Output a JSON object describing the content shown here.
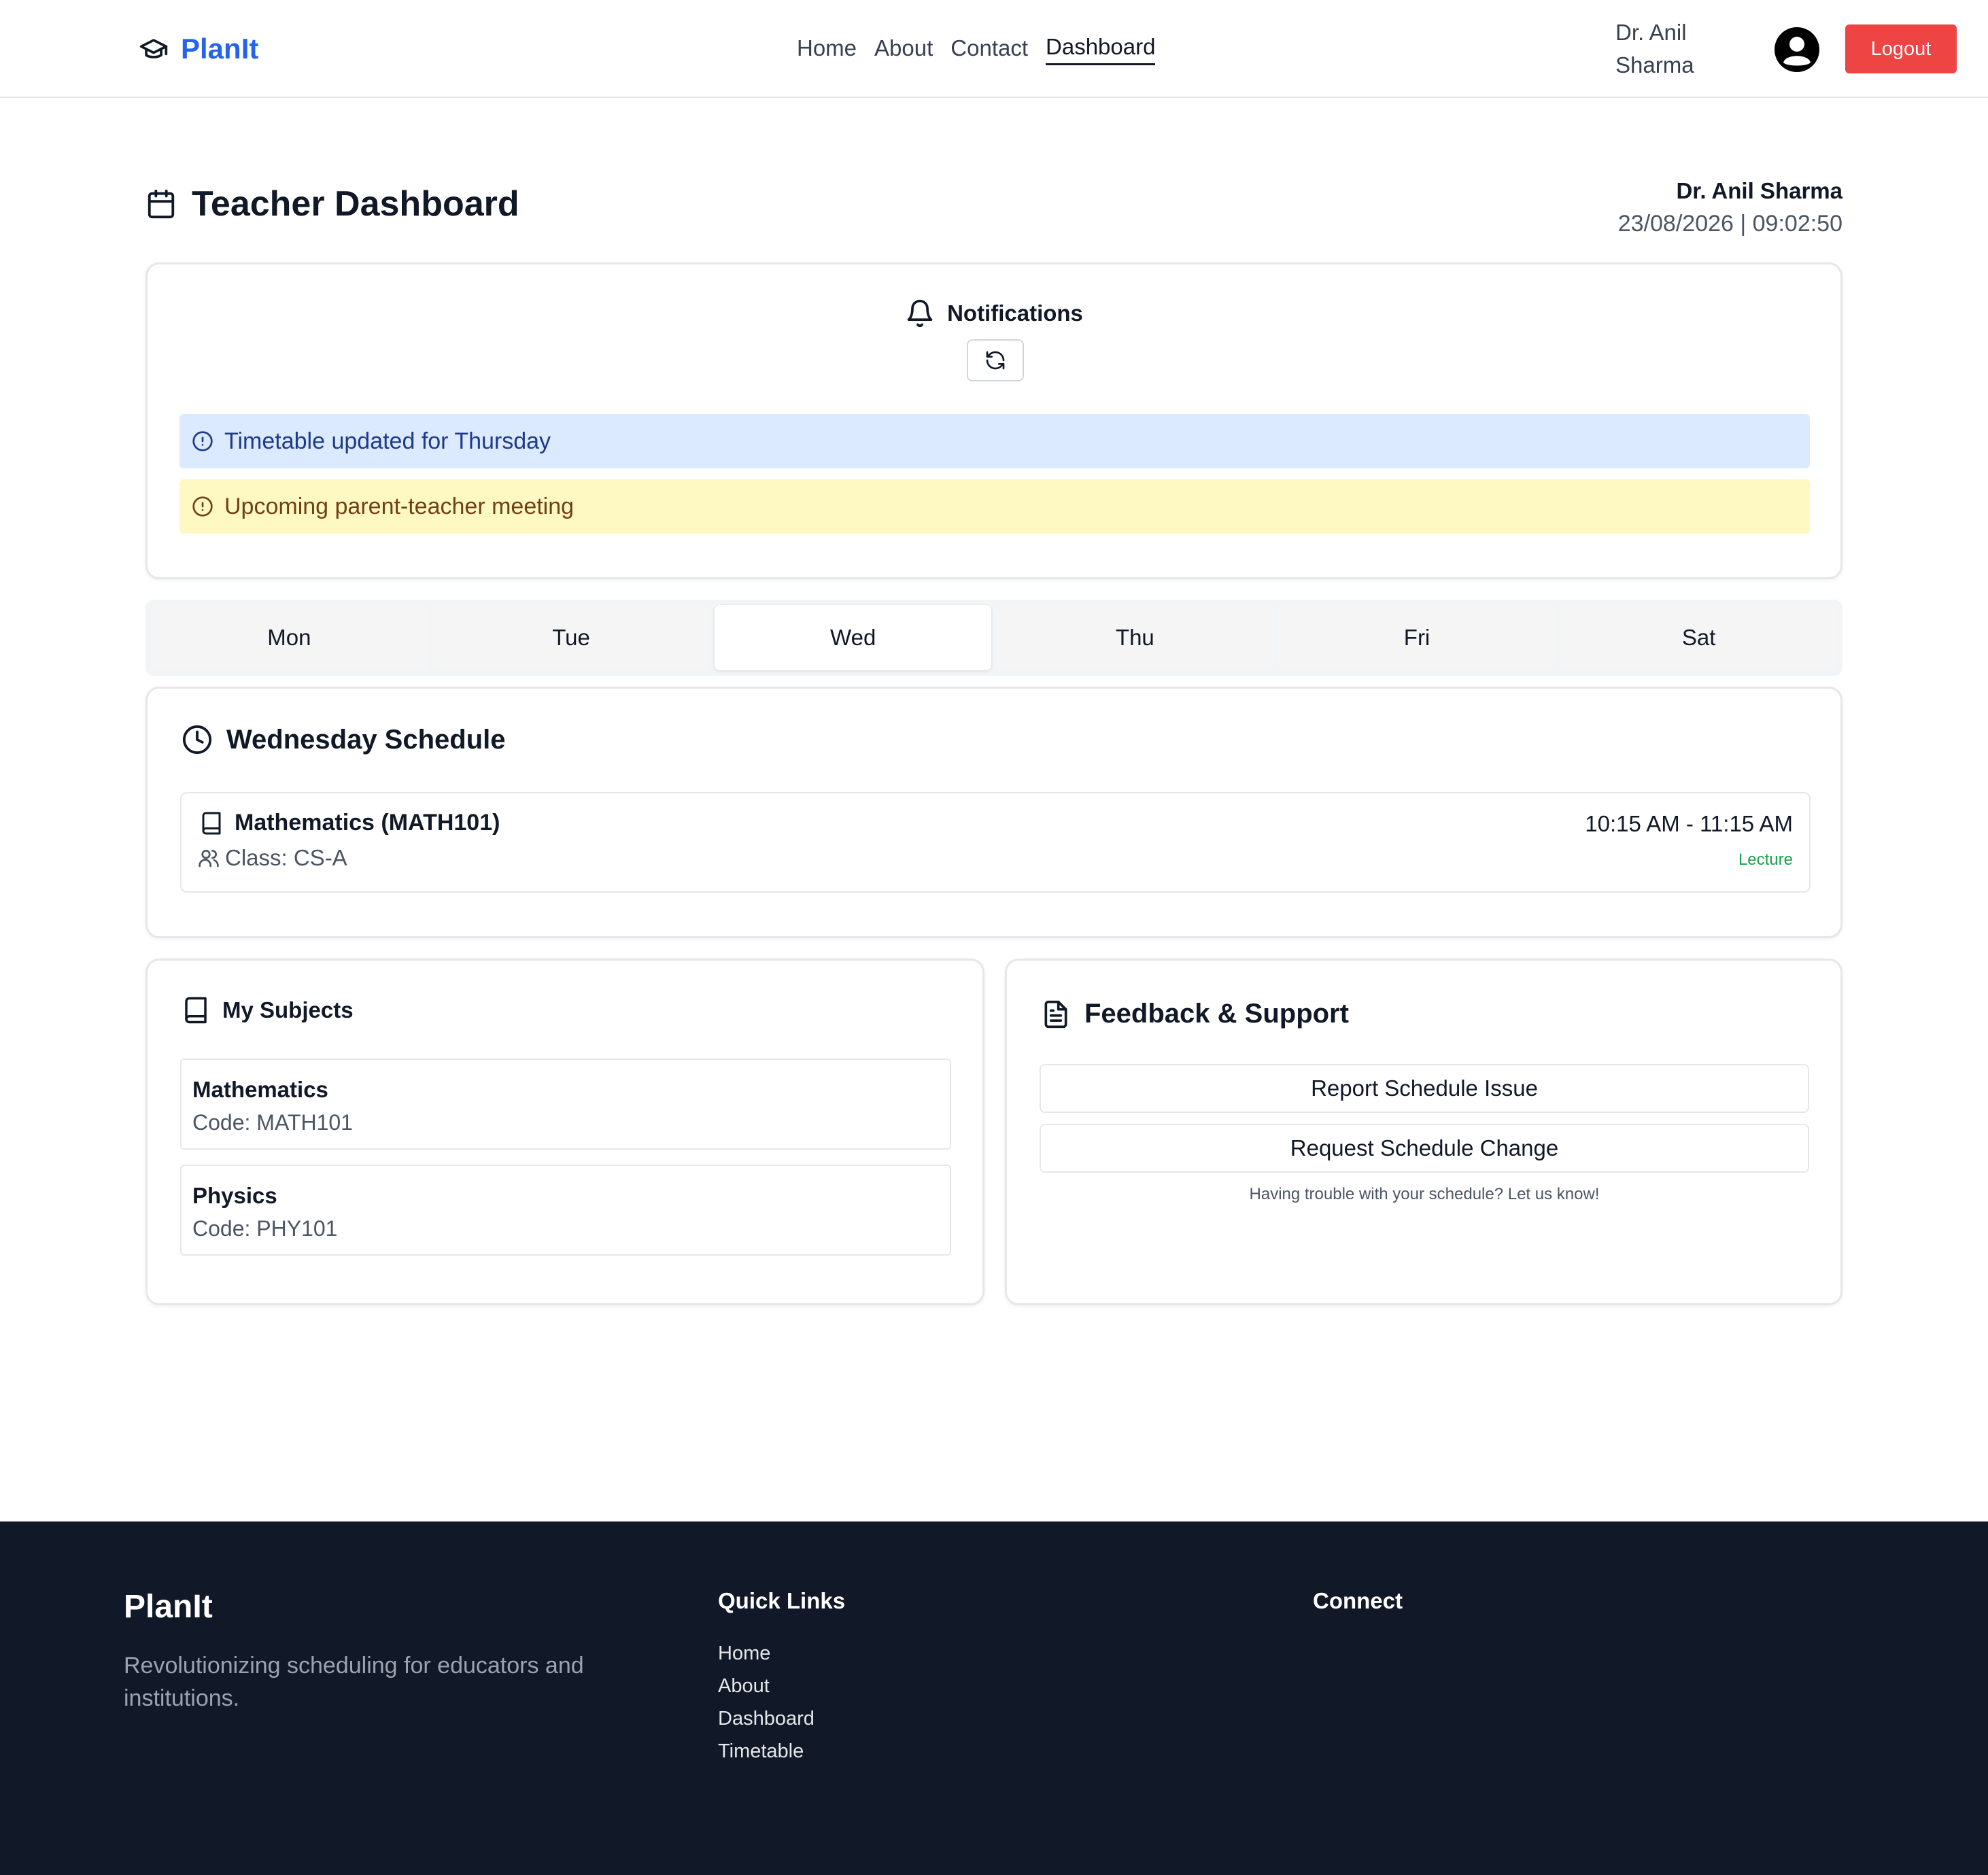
{
  "nav": {
    "brand": "PlanIt",
    "links": [
      "Home",
      "About",
      "Contact",
      "Dashboard"
    ],
    "active_link": "Dashboard",
    "user_name": "Dr. Anil Sharma",
    "logout_label": "Logout"
  },
  "header": {
    "title": "Teacher Dashboard",
    "user_name": "Dr. Anil Sharma",
    "datetime": "23/08/2026 | 09:02:50"
  },
  "notifications": {
    "title": "Notifications",
    "items": [
      {
        "text": "Timetable updated for Thursday",
        "type": "info"
      },
      {
        "text": "Upcoming parent-teacher meeting",
        "type": "warning"
      }
    ]
  },
  "days": {
    "tabs": [
      "Mon",
      "Tue",
      "Wed",
      "Thu",
      "Fri",
      "Sat"
    ],
    "active": "Wed"
  },
  "schedule": {
    "title": "Wednesday Schedule",
    "items": [
      {
        "subject": "Mathematics (MATH101)",
        "class": "Class: CS-A",
        "time": "10:15 AM - 11:15 AM",
        "kind": "Lecture"
      }
    ]
  },
  "subjects": {
    "title": "My Subjects",
    "items": [
      {
        "name": "Mathematics",
        "code": "Code: MATH101"
      },
      {
        "name": "Physics",
        "code": "Code: PHY101"
      }
    ]
  },
  "feedback": {
    "title": "Feedback & Support",
    "buttons": [
      "Report Schedule Issue",
      "Request Schedule Change"
    ],
    "note": "Having trouble with your schedule? Let us know!"
  },
  "footer": {
    "brand": "PlanIt",
    "tagline": "Revolutionizing scheduling for educators and institutions.",
    "quick_links_title": "Quick Links",
    "quick_links": [
      "Home",
      "About",
      "Dashboard",
      "Timetable"
    ],
    "connect_title": "Connect"
  },
  "colors": {
    "brand": "#2563eb",
    "logout": "#ef4444",
    "info_bg": "#dbeafe",
    "warning_bg": "#fef9c3",
    "lecture": "#16a34a",
    "footer_bg": "#111827"
  }
}
